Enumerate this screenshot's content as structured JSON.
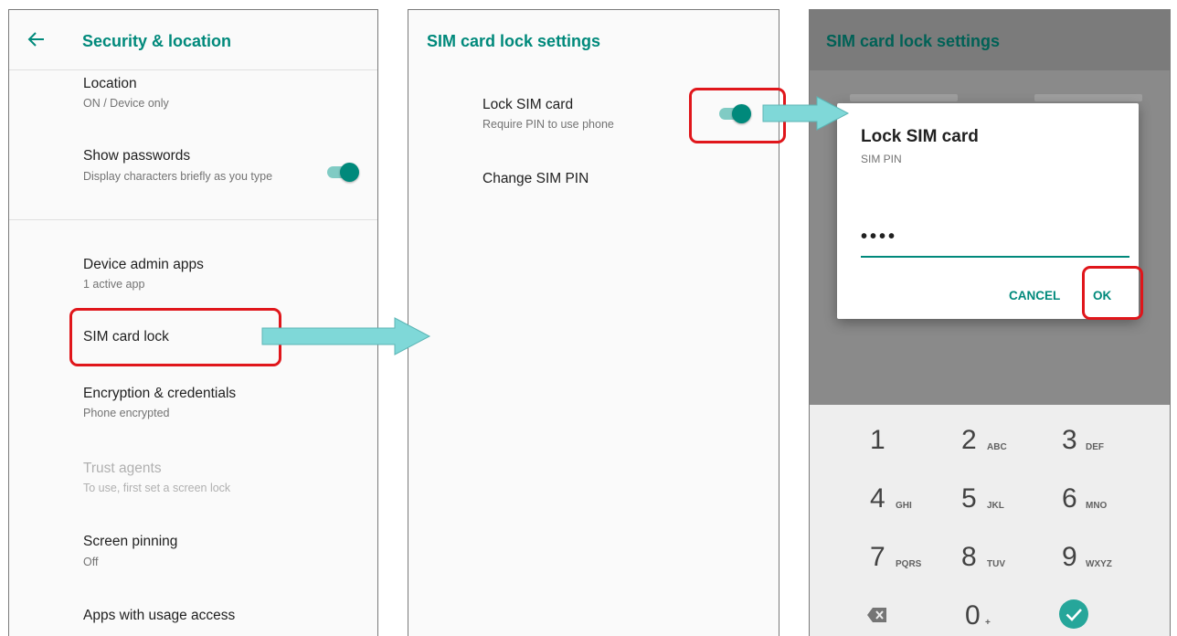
{
  "security_screen": {
    "title": "Security & location",
    "items": [
      {
        "title": "Location",
        "subtitle": "ON / Device only"
      },
      {
        "title": "Show passwords",
        "subtitle": "Display characters briefly as you type",
        "toggle_on": true
      },
      {
        "title": "Device admin apps",
        "subtitle": "1 active app"
      },
      {
        "title": "SIM card lock"
      },
      {
        "title": "Encryption & credentials",
        "subtitle": "Phone encrypted"
      },
      {
        "title": "Trust agents",
        "subtitle": "To use, first set a screen lock",
        "disabled": true
      },
      {
        "title": "Screen pinning",
        "subtitle": "Off"
      },
      {
        "title": "Apps with usage access"
      }
    ]
  },
  "sim_lock_screen": {
    "title": "SIM card lock settings",
    "items": [
      {
        "title": "Lock SIM card",
        "subtitle": "Require PIN to use phone",
        "toggle_on": true
      },
      {
        "title": "Change SIM PIN"
      }
    ]
  },
  "pin_dialog_screen": {
    "title": "SIM card lock settings",
    "dialog": {
      "title": "Lock SIM card",
      "subtitle": "SIM PIN",
      "pin_value": "••••",
      "cancel_label": "CANCEL",
      "ok_label": "OK"
    },
    "keypad": [
      {
        "digit": "1",
        "letters": ""
      },
      {
        "digit": "2",
        "letters": "ABC"
      },
      {
        "digit": "3",
        "letters": "DEF"
      },
      {
        "digit": "4",
        "letters": "GHI"
      },
      {
        "digit": "5",
        "letters": "JKL"
      },
      {
        "digit": "6",
        "letters": "MNO"
      },
      {
        "digit": "7",
        "letters": "PQRS"
      },
      {
        "digit": "8",
        "letters": "TUV"
      },
      {
        "digit": "9",
        "letters": "WXYZ"
      },
      {
        "digit": "0",
        "letters": "+"
      }
    ],
    "keypad_icons": [
      "backspace-icon",
      "checkmark-icon"
    ]
  },
  "colors": {
    "accent": "#00897b",
    "toggle_track": "#80cbc4",
    "highlight": "#e0161b",
    "flow_arrow": "#7fd8d8"
  }
}
